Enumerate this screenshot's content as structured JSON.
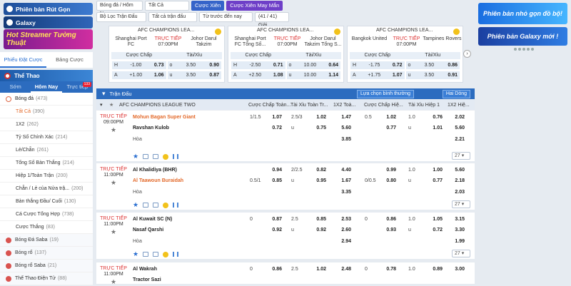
{
  "left_banners": {
    "b1": "Phiên bản Rút Gọn",
    "b2": "Galaxy",
    "b3": "Hot Streamer Tường Thuật"
  },
  "left_tabs": [
    "Phiếu Đặt Cược",
    "Bảng Cược"
  ],
  "sidebar": {
    "title": "Thể Thao",
    "day_tabs": [
      "Sớm",
      "Hôm Nay",
      "Trực tiếp"
    ],
    "live_badge": "133",
    "main_sport": {
      "label": "Bóng đá",
      "count": "(473)"
    },
    "items": [
      {
        "label": "Tất Cả",
        "count": "(390)",
        "hl": true
      },
      {
        "label": "1X2",
        "count": "(262)"
      },
      {
        "label": "Tỷ Số Chính Xác",
        "count": "(214)"
      },
      {
        "label": "Lẻ/Chẵn",
        "count": "(261)"
      },
      {
        "label": "Tổng Số Bàn Thắng",
        "count": "(214)"
      },
      {
        "label": "Hiệp 1/Toàn Trận",
        "count": "(200)"
      },
      {
        "label": "Chẵn / Lẻ của Nửa trậ...",
        "count": "(200)"
      },
      {
        "label": "Bàn thắng Đầu/ Cuối",
        "count": "(130)"
      },
      {
        "label": "Cá Cược Tổng Hợp",
        "count": "(738)"
      },
      {
        "label": "Cược Thắng",
        "count": "(83)"
      }
    ],
    "categories": [
      {
        "label": "Bóng Đá Saba",
        "count": "(19)"
      },
      {
        "label": "Bóng rổ",
        "count": "(137)"
      },
      {
        "label": "Bóng rổ Saba",
        "count": "(21)"
      },
      {
        "label": "Thể Thao Điện Tử",
        "count": "(88)"
      }
    ]
  },
  "topbar": {
    "sport_sel": "Bóng đá / Hôm Nay",
    "all_sel": "Tất Cả",
    "combo_btn": "Cược Xiên",
    "lucky_btn": "Cược Xiên May Mắn"
  },
  "filterbar": {
    "league_filter": "Bộ Lọc Trận Đấu",
    "all_matches": "Tất cả trận đấu",
    "sort": "Từ trước đến nay",
    "count": "(41 / 41) Giải"
  },
  "cards": [
    {
      "league": "AFC CHAMPIONS LEA...",
      "home": "Shanghai Port FC",
      "status": "TRỰC TIẾP",
      "time": "07:00PM",
      "away": "Johor Darul Takzim",
      "h1": "Cược Chấp",
      "h2": "Tài/Xỉu",
      "rows": [
        [
          "H",
          "-1.00",
          "0.73",
          "o",
          "3.50",
          "0.90"
        ],
        [
          "A",
          "+1.00",
          "1.06",
          "u",
          "3.50",
          "0.87"
        ]
      ]
    },
    {
      "league": "AFC CHAMPIONS LEA...",
      "home": "Shanghai Port FC Tổng Số...",
      "status": "TRỰC TIẾP",
      "time": "07:00PM",
      "away": "Johor Darul Takzim Tổng S...",
      "h1": "Cược Chấp",
      "h2": "Tài/Xỉu",
      "rows": [
        [
          "H",
          "-2.50",
          "0.71",
          "o",
          "10.00",
          "0.64"
        ],
        [
          "A",
          "+2.50",
          "1.08",
          "u",
          "10.00",
          "1.14"
        ]
      ]
    },
    {
      "league": "AFC CHAMPIONS LEA...",
      "home": "Bangkok United",
      "status": "TRỰC TIẾP",
      "time": "07:00PM",
      "away": "Tampines Rovers",
      "h1": "Cược Chấp",
      "h2": "Tài/Xỉu",
      "rows": [
        [
          "H",
          "-1.75",
          "0.72",
          "o",
          "3.50",
          "0.86"
        ],
        [
          "A",
          "+1.75",
          "1.07",
          "u",
          "3.50",
          "0.91"
        ]
      ]
    }
  ],
  "right_banners": {
    "b1": "Phiên bản nhỏ gọn đồ bộ!",
    "b2": "Phiên bản Galaxy mới !"
  },
  "main": {
    "title": "Trận Đấu",
    "view_sel": "Lựa chọn bình thường",
    "sort_sel": "Hai Dòng",
    "league": "AFC CHAMPIONS LEAGUE TWO",
    "cols": [
      "Cược Chấp Toàn...",
      "Tài Xỉu Toàn Tr...",
      "1X2 Toà...",
      "Cược Chấp Hiệ...",
      "Tài Xỉu Hiệp 1",
      "1X2 Hiệ..."
    ],
    "draw_label": "Hòa",
    "more": "27",
    "matches": [
      {
        "status": "TRỰC TIẾP",
        "time": "09:00PM",
        "home": "Mohun Bagan Super Giant",
        "away": "Ravshan Kulob",
        "home_hl": true,
        "away_hl": false,
        "r1": [
          "1/1.5",
          "1.07",
          "2.5/3",
          "1.02",
          "1.47",
          "0.5",
          "1.02",
          "1.0",
          "0.76",
          "2.02"
        ],
        "r2": [
          "",
          "0.72",
          "u",
          "0.75",
          "5.60",
          "",
          "0.77",
          "u",
          "1.01",
          "5.60"
        ],
        "r3": [
          "3.85",
          "2.21"
        ]
      },
      {
        "status": "TRỰC TIẾP",
        "time": "11:00PM",
        "home": "Al Khalidiya (BHR)",
        "away": "Al Taawoun Buraidah",
        "home_hl": false,
        "away_hl": true,
        "r1": [
          "",
          "0.94",
          "2/2.5",
          "0.82",
          "4.40",
          "",
          "0.99",
          "1.0",
          "1.00",
          "5.60"
        ],
        "r2": [
          "0.5/1",
          "0.85",
          "u",
          "0.95",
          "1.67",
          "0/0.5",
          "0.80",
          "u",
          "0.77",
          "2.18"
        ],
        "r3": [
          "3.35",
          "2.03"
        ]
      },
      {
        "status": "TRỰC TIẾP",
        "time": "11:00PM",
        "home": "Al Kuwait SC (N)",
        "away": "Nasaf Qarshi",
        "home_hl": false,
        "away_hl": false,
        "r1": [
          "0",
          "0.87",
          "2.5",
          "0.85",
          "2.53",
          "0",
          "0.86",
          "1.0",
          "1.05",
          "3.15"
        ],
        "r2": [
          "",
          "0.92",
          "u",
          "0.92",
          "2.60",
          "",
          "0.93",
          "u",
          "0.72",
          "3.30"
        ],
        "r3": [
          "2.94",
          "1.99"
        ]
      },
      {
        "status": "TRỰC TIẾP",
        "time": "11:00PM",
        "home": "Al Wakrah",
        "away": "Tractor Sazi",
        "home_hl": false,
        "away_hl": false,
        "r1": [
          "0",
          "0.86",
          "2.5",
          "1.02",
          "2.48",
          "0",
          "0.78",
          "1.0",
          "0.89",
          "3.00"
        ]
      }
    ]
  }
}
